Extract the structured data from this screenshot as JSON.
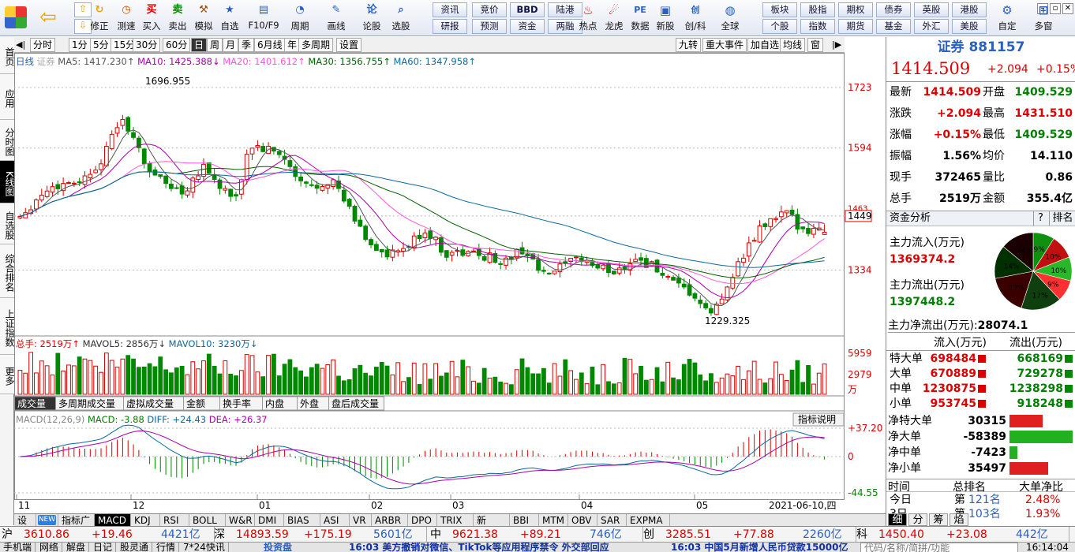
{
  "toolbar": {
    "big": [
      {
        "label": "修正",
        "icon": "refresh-icon"
      },
      {
        "label": "测速",
        "icon": "clock-icon"
      },
      {
        "label": "买入",
        "icon": "buy-icon",
        "glyph": "买"
      },
      {
        "label": "卖出",
        "icon": "sell-icon",
        "glyph": "卖"
      },
      {
        "label": "模拟",
        "icon": "hammer-icon"
      },
      {
        "label": "自选",
        "icon": "star-icon"
      },
      {
        "label": "F10/F9",
        "icon": "f10-icon"
      },
      {
        "label": "周期",
        "icon": "period-icon"
      },
      {
        "label": "画线",
        "icon": "pencil-icon"
      },
      {
        "label": "论股",
        "icon": "discuss-icon",
        "glyph": "论"
      },
      {
        "label": "选股",
        "icon": "magnifier-icon"
      }
    ],
    "grid_top": [
      "资讯",
      "竞价",
      "BBD",
      "陆港"
    ],
    "grid_bot": [
      "研报",
      "预测",
      "资金",
      "两融"
    ],
    "mid": [
      {
        "label": "热点",
        "icon": "hot-icon"
      },
      {
        "label": "龙虎",
        "icon": "dragon-icon"
      },
      {
        "label": "数据",
        "icon": "pe-icon",
        "glyph": "PE"
      },
      {
        "label": "新股",
        "icon": "newstock-icon"
      },
      {
        "label": "创/科",
        "icon": "chuangke-icon",
        "glyph": "创"
      },
      {
        "label": "全球",
        "icon": "globe-icon"
      }
    ],
    "grid2_top": [
      "板块",
      "股指",
      "期权",
      "债券",
      "英股",
      "港股"
    ],
    "grid2_bot": [
      "个股",
      "指数",
      "期货",
      "基金",
      "外汇",
      "美股"
    ],
    "end": [
      {
        "label": "自定",
        "icon": "custom-icon"
      },
      {
        "label": "多窗",
        "icon": "multiwindow-icon"
      }
    ]
  },
  "leftbar": [
    {
      "label": "首页"
    },
    {
      "label": "应用"
    },
    {
      "label": "分时图"
    },
    {
      "label": "K线图",
      "active": true
    },
    {
      "label": "自选股"
    },
    {
      "label": "综合排名"
    },
    {
      "label": "上证指数"
    },
    {
      "label": "更多"
    }
  ],
  "period": {
    "tabs": [
      "分时",
      "1分",
      "5分",
      "15分",
      "30分",
      "60分",
      "日",
      "周",
      "月",
      "季",
      "6月线",
      "年",
      "多周期",
      "设置"
    ],
    "active": "日",
    "right": [
      "九转",
      "重大事件",
      "加自选",
      "均线",
      "窗"
    ]
  },
  "ma": {
    "name": "日线",
    "sec": "证券",
    "items": [
      {
        "t": "MA5: 1417.230↑",
        "c": "#555"
      },
      {
        "t": "MA10: 1425.388↓",
        "c": "#aa00aa"
      },
      {
        "t": "MA20: 1401.612↑",
        "c": "#ff55dd"
      },
      {
        "t": "MA30: 1356.755↑",
        "c": "#006000"
      },
      {
        "t": "MA60: 1347.958↑",
        "c": "#0a6aa0"
      }
    ]
  },
  "vol_legend": [
    {
      "t": "总手: 2519万↑",
      "c": "#d00"
    },
    {
      "t": "MAVOL5: 2856万↓",
      "c": "#333"
    },
    {
      "t": "MAVOL10: 3230万↓",
      "c": "#0a6aa0"
    }
  ],
  "vol_tabs": [
    "成交量",
    "多周期成交量",
    "虚拟成交量",
    "金额",
    "换手率",
    "内盘",
    "外盘",
    "盘后成交量"
  ],
  "macd_legend": [
    {
      "t": "MACD(12,26,9)",
      "c": "#888"
    },
    {
      "t": "MACD: -3.88",
      "c": "#008000"
    },
    {
      "t": "DIFF: +24.43",
      "c": "#0a6aa0"
    },
    {
      "t": "DEA: +26.37",
      "c": "#aa00aa"
    }
  ],
  "macd_help": "指标说明",
  "price_axis": [
    "1723",
    "1594",
    "1449",
    "1334"
  ],
  "price_axis_extra": "1463",
  "vol_axis": [
    "5959",
    "2979",
    "万"
  ],
  "macd_axis": [
    "+37.20",
    "0",
    "-44.55"
  ],
  "months": [
    "11",
    "12",
    "01",
    "02",
    "03",
    "04",
    "05"
  ],
  "date_label": "2021-06-10,四",
  "peaks": {
    "high": "1696.955",
    "low": "1229.325"
  },
  "quote": {
    "title": "证券 881157",
    "price": "1414.509",
    "change": "+2.094",
    "pct": "+0.15%",
    "rows": [
      {
        "l": "最新",
        "v": "1414.509",
        "vc": "red",
        "l2": "开盘",
        "v2": "1409.529",
        "v2c": "green"
      },
      {
        "l": "涨跌",
        "v": "+2.094",
        "vc": "red",
        "l2": "最高",
        "v2": "1431.510",
        "v2c": "red"
      },
      {
        "l": "涨幅",
        "v": "+0.15%",
        "vc": "red",
        "l2": "最低",
        "v2": "1409.529",
        "v2c": "green"
      },
      {
        "l": "振幅",
        "v": "1.56%",
        "vc": "black",
        "l2": "均价",
        "v2": "14.110",
        "v2c": "black"
      },
      {
        "l": "现手",
        "v": "372465",
        "vc": "black",
        "l2": "量比",
        "v2": "0.86",
        "v2c": "black"
      },
      {
        "l": "总手",
        "v": "2519万",
        "vc": "black",
        "l2": "金额",
        "v2": "355.4亿",
        "v2c": "black"
      }
    ]
  },
  "capital": {
    "title": "资金分析",
    "q": "?",
    "rank": "排名",
    "in_label": "主力流入(万元)",
    "in_value": "1369374.2",
    "out_label": "主力流出(万元)",
    "out_value": "1397448.2",
    "net_label": "主力净流出(万元):",
    "net_value": "28074.1",
    "pie": [
      {
        "label": "9%",
        "v": 9,
        "c": "#109010"
      },
      {
        "label": "10%",
        "v": 10,
        "c": "#c01010"
      },
      {
        "label": "10%",
        "v": 10,
        "c": "#28b828"
      },
      {
        "label": "9%",
        "v": 9,
        "c": "#ff3030"
      },
      {
        "label": "17%",
        "v": 17,
        "c": "#0f3f0f"
      },
      {
        "label": "17%",
        "v": 17,
        "c": "#3a0000"
      },
      {
        "label": "14%",
        "v": 14,
        "c": "#003000"
      },
      {
        "label": "14%",
        "v": 14,
        "c": "#1a0000"
      }
    ],
    "flow_head": [
      "流入(万元)",
      "流出(万元)"
    ],
    "flows": [
      {
        "n": "特大单",
        "in": "698484",
        "out": "668169"
      },
      {
        "n": "大单",
        "in": "670889",
        "out": "729278"
      },
      {
        "n": "中单",
        "in": "1230875",
        "out": "1238298"
      },
      {
        "n": "小单",
        "in": "953745",
        "out": "918248"
      }
    ],
    "nets": [
      {
        "n": "净特大单",
        "v": "30315",
        "frac": 0.52,
        "c": "#e02020"
      },
      {
        "n": "净大单",
        "v": "-58389",
        "frac": 1.0,
        "c": "#20b020"
      },
      {
        "n": "净中单",
        "v": "-7423",
        "frac": 0.13,
        "c": "#20b020"
      },
      {
        "n": "净小单",
        "v": "35497",
        "frac": 0.61,
        "c": "#e02020"
      }
    ],
    "time_head": [
      "时间",
      "总排名",
      "大单净比"
    ],
    "time_rows": [
      {
        "t": "今日",
        "r": "第",
        "n": "121名",
        "p": "2.48%"
      },
      {
        "t": "3日",
        "r": "第",
        "n": "103名",
        "p": "1.93%"
      }
    ],
    "tabs": [
      "细",
      "分",
      "筹",
      "焰"
    ]
  },
  "bottom_tabs": [
    {
      "l": "设置"
    },
    {
      "l": "NEW",
      "badge": true
    },
    {
      "l": "指标广场"
    },
    {
      "l": "MACD",
      "act": true
    },
    {
      "l": "KDJ"
    },
    {
      "l": "RSI"
    },
    {
      "l": "BOLL"
    },
    {
      "l": "W&R"
    },
    {
      "l": "DMI"
    },
    {
      "l": "BIAS"
    },
    {
      "l": "ASI"
    },
    {
      "l": "VR"
    },
    {
      "l": "ARBR"
    },
    {
      "l": "DPO"
    },
    {
      "l": "TRIX"
    },
    {
      "l": "新DMA"
    },
    {
      "l": "BBI"
    },
    {
      "l": "MTM"
    },
    {
      "l": "OBV"
    },
    {
      "l": "SAR"
    },
    {
      "l": "EXPMA"
    }
  ],
  "ticker": [
    {
      "n": "沪",
      "p": "3610.86",
      "c": "+19.46",
      "a": "4421亿"
    },
    {
      "n": "深",
      "p": "14893.59",
      "c": "+175.19",
      "a": "5601亿"
    },
    {
      "n": "中",
      "p": "9621.38",
      "c": "+89.21",
      "a": "746亿"
    },
    {
      "n": "创",
      "p": "3285.51",
      "c": "+77.88",
      "a": "2260亿"
    },
    {
      "n": "科",
      "p": "1450.40",
      "c": "+23.08",
      "a": "442亿"
    }
  ],
  "status": {
    "items": [
      "手机端",
      "网络",
      "解盘",
      "日记",
      "股灵通",
      "行情",
      "7*24快讯"
    ],
    "brand": "投资盘",
    "news1": "16:03 美方撤销对微信、TikTok等应用程序禁令 外交部回应",
    "news2": "16:03 中国5月新增人民币贷款15000亿",
    "search": "代码/名称/简拼/功能",
    "time": "16:14:04"
  }
}
